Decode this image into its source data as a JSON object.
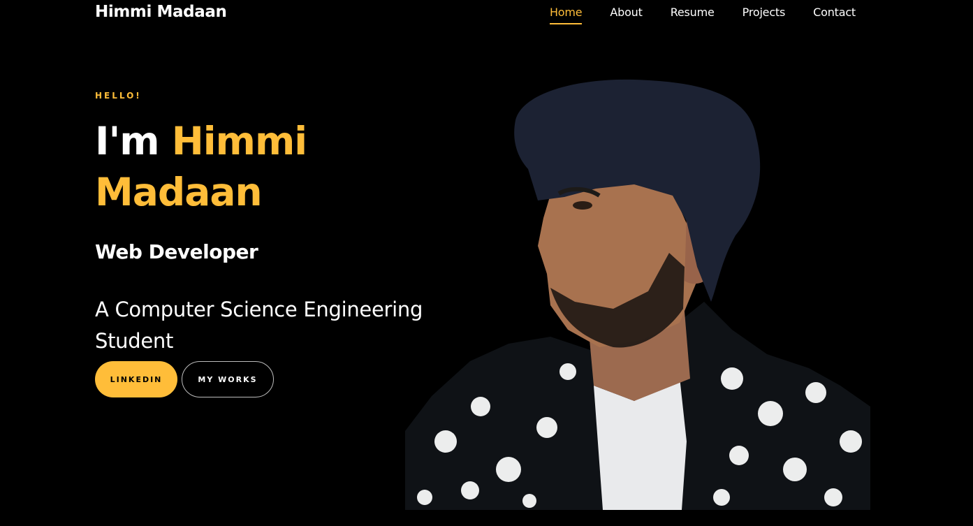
{
  "brand": {
    "name": "Himmi Madaan"
  },
  "nav": {
    "items": [
      {
        "label": "Home",
        "active": true
      },
      {
        "label": "About",
        "active": false
      },
      {
        "label": "Resume",
        "active": false
      },
      {
        "label": "Projects",
        "active": false
      },
      {
        "label": "Contact",
        "active": false
      }
    ]
  },
  "hero": {
    "greeting": "HELLO!",
    "title_prefix": "I'm ",
    "title_name": "Himmi Madaan",
    "role": "Web Developer",
    "bio": "A Computer Science Engineering Student",
    "buttons": {
      "linkedin": "LINKEDIN",
      "works": "MY WORKS"
    }
  },
  "colors": {
    "accent": "#ffbd39",
    "background": "#000000",
    "text": "#ffffff"
  }
}
